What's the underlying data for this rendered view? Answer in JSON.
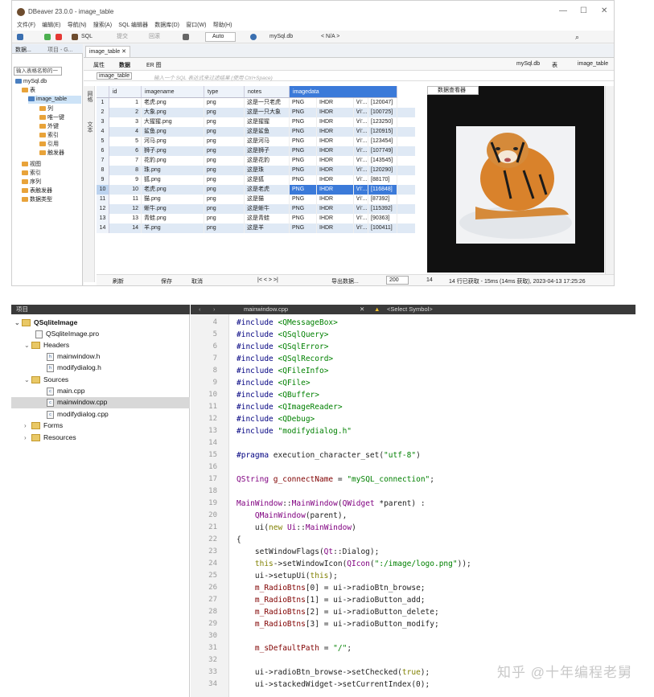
{
  "dbeaver": {
    "title": "DBeaver 23.0.0 - image_table",
    "window_controls": [
      "—",
      "☐",
      "✕"
    ],
    "menu": [
      "文件(F)",
      "编辑(E)",
      "导航(N)",
      "搜索(A)",
      "SQL 编辑器",
      "数据库(D)",
      "窗口(W)",
      "帮助(H)"
    ],
    "toolbar": {
      "sql": "SQL",
      "commit": "提交",
      "rollback": "回滚",
      "auto": "Auto",
      "db": "mySql.db",
      "na": "< N/A >"
    },
    "navigator": {
      "tabs": [
        "数据...",
        "项目 - G..."
      ],
      "filter_placeholder": "输入表格名称的一",
      "tree": [
        {
          "label": "mySql.db",
          "level": 0
        },
        {
          "label": "表",
          "level": 1
        },
        {
          "label": "image_table",
          "level": 2
        },
        {
          "label": "列",
          "level": 3
        },
        {
          "label": "唯一键",
          "level": 3
        },
        {
          "label": "外键",
          "level": 3
        },
        {
          "label": "索引",
          "level": 3
        },
        {
          "label": "引用",
          "level": 3
        },
        {
          "label": "触发器",
          "level": 3
        },
        {
          "label": "视图",
          "level": 1
        },
        {
          "label": "索引",
          "level": 1
        },
        {
          "label": "序列",
          "level": 1
        },
        {
          "label": "表触发器",
          "level": 1
        },
        {
          "label": "数据类型",
          "level": 1
        }
      ]
    },
    "editor": {
      "tab": "image_table",
      "subtabs": [
        "属性",
        "数据",
        "ER 图"
      ],
      "right_db": "mySql.db",
      "right_schema": "表",
      "right_table": "image_table",
      "filter_label": "image_table",
      "filter_placeholder": "输入一个 SQL 表达式来过滤结果 (使用 Ctrl+Space)",
      "side_labels": [
        "网格",
        "文本"
      ],
      "columns": [
        "id",
        "imagename",
        "type",
        "notes",
        "imagedata"
      ],
      "rows": [
        {
          "n": "1",
          "id": "1",
          "imagename": "老虎.png",
          "type": "png",
          "notes": "这是一只老虎",
          "fmt": "PNG",
          "ihdr": "IHDR",
          "blob": "\\r\\'...",
          "size": "[120047]"
        },
        {
          "n": "2",
          "id": "2",
          "imagename": "大象.png",
          "type": "png",
          "notes": "这是一只大象",
          "fmt": "PNG",
          "ihdr": "IHDR",
          "blob": "\\r\\'...",
          "size": "[100725]"
        },
        {
          "n": "3",
          "id": "3",
          "imagename": "大猩猩.png",
          "type": "png",
          "notes": "这是猩猩",
          "fmt": "PNG",
          "ihdr": "IHDR",
          "blob": "\\r\\'...",
          "size": "[123250]"
        },
        {
          "n": "4",
          "id": "4",
          "imagename": "鲨鱼.png",
          "type": "png",
          "notes": "这是鲨鱼",
          "fmt": "PNG",
          "ihdr": "IHDR",
          "blob": "\\r\\'...",
          "size": "[120915]"
        },
        {
          "n": "5",
          "id": "5",
          "imagename": "河马.png",
          "type": "png",
          "notes": "这是河马",
          "fmt": "PNG",
          "ihdr": "IHDR",
          "blob": "\\r\\'...",
          "size": "[123454]"
        },
        {
          "n": "6",
          "id": "6",
          "imagename": "狮子.png",
          "type": "png",
          "notes": "这是狮子",
          "fmt": "PNG",
          "ihdr": "IHDR",
          "blob": "\\r\\'...",
          "size": "[107749]"
        },
        {
          "n": "7",
          "id": "7",
          "imagename": "花豹.png",
          "type": "png",
          "notes": "这是花豹",
          "fmt": "PNG",
          "ihdr": "IHDR",
          "blob": "\\r\\'...",
          "size": "[143545]"
        },
        {
          "n": "8",
          "id": "8",
          "imagename": "珠.png",
          "type": "png",
          "notes": "这是珠",
          "fmt": "PNG",
          "ihdr": "IHDR",
          "blob": "\\r\\'...",
          "size": "[120290]"
        },
        {
          "n": "9",
          "id": "9",
          "imagename": "狐.png",
          "type": "png",
          "notes": "这是狐",
          "fmt": "PNG",
          "ihdr": "IHDR",
          "blob": "\\r\\'...",
          "size": "[88170]"
        },
        {
          "n": "10",
          "id": "10",
          "imagename": "老虎.png",
          "type": "png",
          "notes": "这是老虎",
          "fmt": "PNG",
          "ihdr": "IHDR",
          "blob": "\\r\\'...",
          "size": "[116848]"
        },
        {
          "n": "11",
          "id": "11",
          "imagename": "猫.png",
          "type": "png",
          "notes": "这是猫",
          "fmt": "PNG",
          "ihdr": "IHDR",
          "blob": "\\r\\'...",
          "size": "[87392]"
        },
        {
          "n": "12",
          "id": "12",
          "imagename": "蜥牛.png",
          "type": "png",
          "notes": "这是蜥牛",
          "fmt": "PNG",
          "ihdr": "IHDR",
          "blob": "\\r\\'...",
          "size": "[115392]"
        },
        {
          "n": "13",
          "id": "13",
          "imagename": "青蛙.png",
          "type": "png",
          "notes": "这是青蛙",
          "fmt": "PNG",
          "ihdr": "IHDR",
          "blob": "\\r\\'...",
          "size": "[90363]"
        },
        {
          "n": "14",
          "id": "14",
          "imagename": "羊.png",
          "type": "png",
          "notes": "这是羊",
          "fmt": "PNG",
          "ihdr": "IHDR",
          "blob": "\\r\\'...",
          "size": "[100411]"
        }
      ],
      "viewer_tab": "数据查看器",
      "status": {
        "refresh": "刷新",
        "save": "保存",
        "cancel": "取消",
        "export": "导出数据...",
        "limit": "200",
        "count": "14",
        "info": "14 行已获取 - 15ms (14ms 获取), 2023-04-13 17:25:26"
      }
    }
  },
  "qt": {
    "project_header": "项目",
    "editor_file": "mainwindow.cpp",
    "symbol": "<Select Symbol>",
    "tree": [
      {
        "label": "QSqliteImage",
        "kind": "project"
      },
      {
        "label": "QSqliteImage.pro",
        "kind": "file"
      },
      {
        "label": "Headers",
        "kind": "folder"
      },
      {
        "label": "mainwindow.h",
        "kind": "file"
      },
      {
        "label": "modifydialog.h",
        "kind": "file"
      },
      {
        "label": "Sources",
        "kind": "folder"
      },
      {
        "label": "main.cpp",
        "kind": "file"
      },
      {
        "label": "mainwindow.cpp",
        "kind": "file"
      },
      {
        "label": "modifydialog.cpp",
        "kind": "file"
      },
      {
        "label": "Forms",
        "kind": "folder"
      },
      {
        "label": "Resources",
        "kind": "folder"
      }
    ],
    "line_numbers": [
      "4",
      "5",
      "6",
      "7",
      "8",
      "9",
      "10",
      "11",
      "12",
      "13",
      "14",
      "15",
      "16",
      "17",
      "18",
      "19",
      "20",
      "21",
      "22",
      "23",
      "24",
      "25",
      "26",
      "27",
      "28",
      "29",
      "30",
      "31",
      "32",
      "33",
      "34"
    ],
    "code_lines": [
      "#include <QMessageBox>",
      "#include <QSqlQuery>",
      "#include <QSqlError>",
      "#include <QSqlRecord>",
      "#include <QFileInfo>",
      "#include <QFile>",
      "#include <QBuffer>",
      "#include <QImageReader>",
      "#include <QDebug>",
      "#include \"modifydialog.h\"",
      "",
      "#pragma execution_character_set(\"utf-8\")",
      "",
      "QString g_connectName = \"mySQL_connection\";",
      "",
      "MainWindow::MainWindow(QWidget *parent) :",
      "    QMainWindow(parent),",
      "    ui(new Ui::MainWindow)",
      "{",
      "    setWindowFlags(Qt::Dialog);",
      "    this->setWindowIcon(QIcon(\":/image/logo.png\"));",
      "    ui->setupUi(this);",
      "    m_RadioBtns[0] = ui->radioBtn_browse;",
      "    m_RadioBtns[1] = ui->radioButton_add;",
      "    m_RadioBtns[2] = ui->radioButton_delete;",
      "    m_RadioBtns[3] = ui->radioButton_modify;",
      "",
      "    m_sDefaultPath = \"/\";",
      "",
      "    ui->radioBtn_browse->setChecked(true);",
      "    ui->stackedWidget->setCurrentIndex(0);"
    ],
    "watermark": "知乎 @十年编程老舅"
  }
}
